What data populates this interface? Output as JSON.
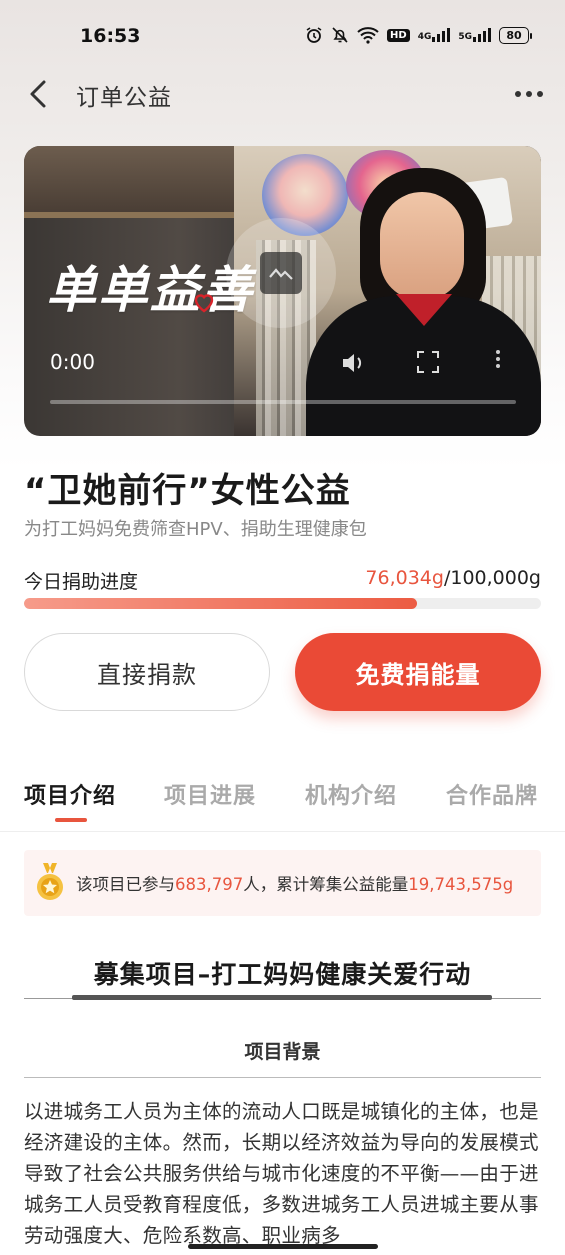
{
  "status_bar": {
    "time": "16:53",
    "icons": [
      "alarm-icon",
      "mute-icon",
      "wifi-icon",
      "hd-icon",
      "4g-signal-icon",
      "5g-signal-icon",
      "battery-icon"
    ],
    "hd": "HD",
    "net1": "4G",
    "net2": "5G",
    "battery": "80"
  },
  "nav": {
    "title": "订单公益"
  },
  "video": {
    "logo_text": "单单益善",
    "time": "0:00",
    "progress": 0
  },
  "project": {
    "title": "“卫她前行”女性公益",
    "subtitle": "为打工妈妈免费筛查HPV、捐助生理健康包",
    "progress_label": "今日捐助进度",
    "progress_current": "76,034g",
    "progress_total": "/100,000g",
    "progress_fraction": 0.76034
  },
  "buttons": {
    "donate": "直接捐款",
    "energy": "免费捐能量"
  },
  "tabs": [
    {
      "label": "项目介绍",
      "active": true
    },
    {
      "label": "项目进展",
      "active": false
    },
    {
      "label": "机构介绍",
      "active": false
    },
    {
      "label": "合作品牌",
      "active": false
    }
  ],
  "stats": {
    "prefix": "该项目已参与",
    "participants": "683,797",
    "middle": "人，累计筹集公益能量",
    "energy_total": "19,743,575g"
  },
  "content": {
    "section_title": "募集项目–打工妈妈健康关爱行动",
    "sub_title": "项目背景",
    "paragraph": "以进城务工人员为主体的流动人口既是城镇化的主体，也是经济建设的主体。然而，长期以经济效益为导向的发展模式导致了社会公共服务供给与城市化速度的不平衡——由于进城务工人员受教育程度低，多数进城务工人员进城主要从事劳动强度大、危险系数高、职业病多"
  },
  "colors": {
    "accent": "#e8553e",
    "button_red": "#ea4a36",
    "stats_bg": "#fdf3f2"
  }
}
